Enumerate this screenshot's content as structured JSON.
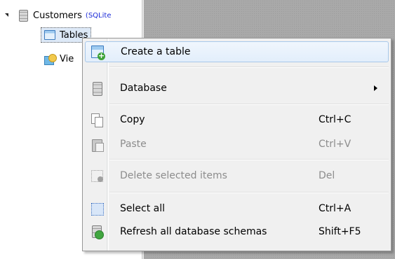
{
  "tree": {
    "database": {
      "label": "Customers",
      "sublabel": "(SQLite"
    },
    "tables_label": "Tables",
    "views_label": "Vie"
  },
  "context_menu": {
    "items": [
      {
        "label": "Create a table",
        "shortcut": "",
        "icon": "create-table-icon",
        "disabled": false,
        "highlighted": true
      },
      {
        "label": "Database",
        "shortcut": "",
        "icon": "database-icon",
        "disabled": false,
        "submenu": true
      },
      {
        "label": "Copy",
        "shortcut": "Ctrl+C",
        "icon": "copy-icon",
        "disabled": false
      },
      {
        "label": "Paste",
        "shortcut": "Ctrl+V",
        "icon": "paste-icon",
        "disabled": true
      },
      {
        "label": "Delete selected items",
        "shortcut": "Del",
        "icon": "delete-icon",
        "disabled": true
      },
      {
        "label": "Select all",
        "shortcut": "Ctrl+A",
        "icon": "select-all-icon",
        "disabled": false
      },
      {
        "label": "Refresh all database schemas",
        "shortcut": "Shift+F5",
        "icon": "refresh-icon",
        "disabled": false
      }
    ]
  },
  "colors": {
    "highlight_border": "#a8c8ea",
    "disabled_text": "#8c8c8c",
    "sublabel_text": "#1a2ad8",
    "background_panel": "#a9a9a9"
  }
}
